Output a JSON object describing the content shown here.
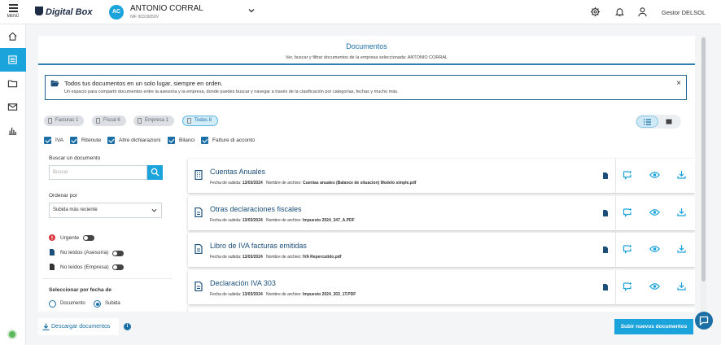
{
  "topbar": {
    "menu_label": "MENÚ",
    "brand": "Digital Box",
    "client_initials": "AC",
    "client_name": "ANTONIO CORRAL",
    "client_nif": "NIF 00319050V",
    "user_name": "Gestor DELSOL"
  },
  "panel": {
    "title": "Documentos",
    "subtitle": "Ver, buscar y filtrar documentos de la empresa seleccionada: ANTONIO CORRAL"
  },
  "info": {
    "title": "Todos tus documentos en un solo lugar, siempre en orden.",
    "text": "Un espacio para compartir documentos entre la asesoría y la empresa, donde puedes buscar y navegar a través de la clasificación por categorías, fechas y mucho más.",
    "close": "×"
  },
  "chips": [
    {
      "label": "Facturas 1"
    },
    {
      "label": "Fiscal 6"
    },
    {
      "label": "Empresa 1"
    },
    {
      "label": "Todos 8"
    }
  ],
  "checkboxes": [
    {
      "label": "IVA"
    },
    {
      "label": "Ritenute"
    },
    {
      "label": "Altre dichiarazioni"
    },
    {
      "label": "Bilanci"
    },
    {
      "label": "Fatture di acconto"
    }
  ],
  "filters": {
    "search_label": "Buscar un documento",
    "search_placeholder": "Buscar",
    "order_label": "Ordenar por",
    "order_value": "Subida más reciente",
    "urgent_label": "Urgente",
    "unread_advisory_label": "No leídos (Asesoría)",
    "unread_company_label": "No leídos (Empresa)",
    "date_label": "Seleccionar por fecha de",
    "radio_document": "Documento",
    "radio_upload": "Subida"
  },
  "documents": [
    {
      "title": "Cuentas Anuales",
      "date_label": "Fecha de subida:",
      "date": "13/03/2024",
      "file_label": "Nombre de archivo:",
      "file": "Cuentas anuales (Balance de situacion) Modelo simple.pdf",
      "icon": "building-icon"
    },
    {
      "title": "Otras declaraciones fiscales",
      "date_label": "Fecha de subida:",
      "date": "13/03/2024",
      "file_label": "Nombre de archivo:",
      "file": "Impuesto 2024_347_A.PDF",
      "icon": "document-icon"
    },
    {
      "title": "Libro de IVA facturas emitidas",
      "date_label": "Fecha de subida:",
      "date": "13/03/2024",
      "file_label": "Nombre de archivo:",
      "file": "IVA Repercutido.pdf",
      "icon": "document-icon"
    },
    {
      "title": "Declaración IVA 303",
      "date_label": "Fecha de subida:",
      "date": "13/03/2024",
      "file_label": "Nombre de archivo:",
      "file": "Impuesto 2024_303_1T.PDF",
      "icon": "document-icon"
    }
  ],
  "footer": {
    "download_label": "Descargar documentos",
    "info": "i",
    "upload_label": "Subir nuevos documentos"
  },
  "colors": {
    "accent": "#1ba3db",
    "primary_dark": "#1b6fa5",
    "urgent": "#d9363e"
  }
}
